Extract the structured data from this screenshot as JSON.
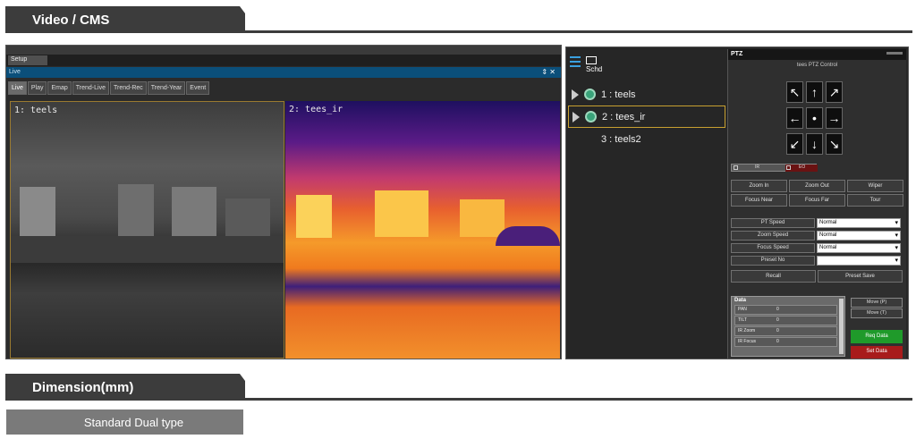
{
  "sections": {
    "video_cms": "Video / CMS",
    "dimension": "Dimension(mm)",
    "standard": "Standard Dual type"
  },
  "app": {
    "menu_setup": "Setup",
    "live_bar": "Live",
    "live_ctrl": "⇕ ✕",
    "tabs": [
      "Live",
      "Play",
      "Emap",
      "Trend-Live",
      "Trend-Rec",
      "Trend-Year",
      "Event"
    ],
    "video1_label": "1: teels",
    "video2_label": "2: tees_ir"
  },
  "right": {
    "schd": "Schd",
    "cameras": [
      {
        "label": "1 : teels",
        "icon": "camera-icon"
      },
      {
        "label": "2 : tees_ir",
        "icon": "camera-icon"
      },
      {
        "label": "3 : teels2",
        "icon": ""
      }
    ],
    "ptz": {
      "title": "PTZ",
      "subtitle": "tees PTZ Control",
      "arrows": [
        "↖",
        "↑",
        "↗",
        "←",
        "•",
        "→",
        "↙",
        "↓",
        "↘"
      ],
      "mode_ir": "IR",
      "mode_eo": "EO",
      "buttons": [
        "Zoom In",
        "Zoom Out",
        "Wiper",
        "Focus Near",
        "Focus Far",
        "Tour"
      ],
      "speeds": [
        {
          "label": "PT Speed",
          "value": "Normal"
        },
        {
          "label": "Zoom Speed",
          "value": "Normal"
        },
        {
          "label": "Focus Speed",
          "value": "Normal"
        }
      ],
      "preset_no": "Preset No",
      "recall": "Recall",
      "preset_save": "Preset Save",
      "data_title": "Data",
      "data_rows": [
        {
          "label": "PAN",
          "value": "0"
        },
        {
          "label": "TILT",
          "value": "0"
        },
        {
          "label": "IR Zoom",
          "value": "0"
        },
        {
          "label": "IR Focus",
          "value": "0"
        }
      ],
      "move_p": "Move (P)",
      "move_t": "Move (T)",
      "req_data": "Req Data",
      "set_data": "Set Data"
    }
  },
  "colors": {
    "header": "#3c3c3c",
    "live_bar": "#0b4f7a",
    "req_data": "#1f9a2a",
    "set_data": "#a81b1b",
    "selection": "#c8a030"
  }
}
